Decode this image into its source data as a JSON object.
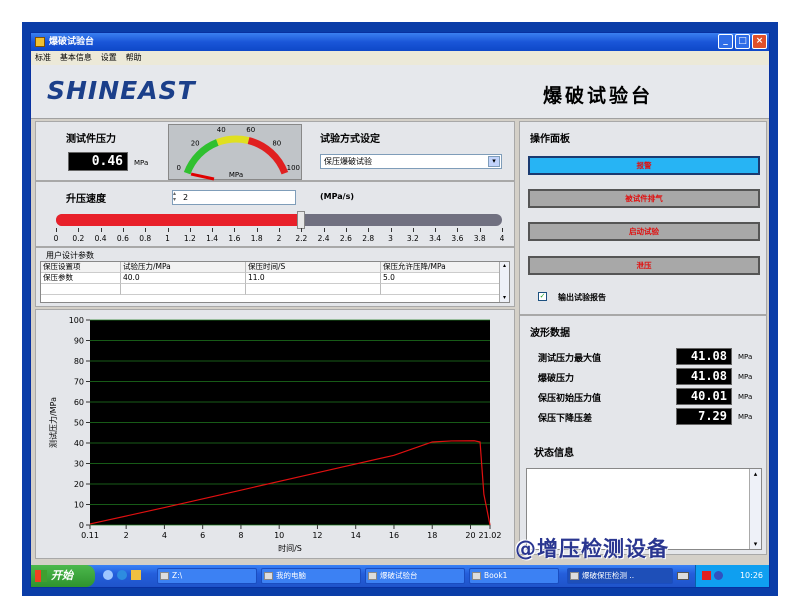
{
  "window": {
    "title": "爆破试验台"
  },
  "menu": [
    "标准",
    "基本信息",
    "设置",
    "帮助"
  ],
  "header": {
    "logo": "SHINEAST",
    "app_title": "爆破试验台"
  },
  "pressure": {
    "label": "测试件压力",
    "value": "0.46",
    "unit": "MPa"
  },
  "gauge": {
    "unit": "MPa",
    "ticks": [
      "0",
      "20",
      "40",
      "60",
      "80",
      "100"
    ],
    "needle_value": 0.46,
    "max": 100
  },
  "mode": {
    "label": "试验方式设定",
    "selected": "保压爆破试验"
  },
  "rate": {
    "label": "升压速度",
    "value": "2",
    "unit": "(MPa/s)",
    "slider_fraction": 0.55,
    "ticks": [
      "0",
      "0.2",
      "0.4",
      "0.6",
      "0.8",
      "1",
      "1.2",
      "1.4",
      "1.6",
      "1.8",
      "2",
      "2.2",
      "2.4",
      "2.6",
      "2.8",
      "3",
      "3.2",
      "3.4",
      "3.6",
      "3.8",
      "4"
    ]
  },
  "params": {
    "title": "用户设计参数",
    "headers": [
      "保压设置项",
      "试验压力/MPa",
      "保压时间/S",
      "保压允许压降/MPa"
    ],
    "rows": [
      [
        "保压参数",
        "40.0",
        "11.0",
        "5.0"
      ]
    ]
  },
  "ops": {
    "title": "操作面板",
    "buttons": [
      "报警",
      "被试件排气",
      "启动试验",
      "泄压"
    ],
    "export_label": "输出试验报告",
    "export_checked": true
  },
  "wave": {
    "title": "波形数据",
    "rows": [
      {
        "label": "测试压力最大值",
        "value": "41.08",
        "unit": "MPa"
      },
      {
        "label": "爆破压力",
        "value": "41.08",
        "unit": "MPa"
      },
      {
        "label": "保压初始压力值",
        "value": "40.01",
        "unit": "MPa"
      },
      {
        "label": "保压下降压差",
        "value": "7.29",
        "unit": "MPa"
      }
    ]
  },
  "status": {
    "title": "状态信息"
  },
  "chart_data": {
    "type": "line",
    "xlabel": "时间/S",
    "ylabel": "测试压力/MPa",
    "xlim": [
      0.11,
      21.02
    ],
    "ylim": [
      0,
      100
    ],
    "x_ticks": [
      "0.11",
      "2",
      "4",
      "6",
      "8",
      "10",
      "12",
      "14",
      "16",
      "18",
      "20",
      "21.02"
    ],
    "y_ticks": [
      "0",
      "10",
      "20",
      "30",
      "40",
      "50",
      "60",
      "70",
      "80",
      "90",
      "100"
    ],
    "series": [
      {
        "x": [
          0.11,
          4,
          8,
          12,
          16,
          18,
          19,
          20.2,
          20.5,
          20.7,
          21.02
        ],
        "y": [
          0.5,
          8.5,
          17,
          25.5,
          34,
          40.5,
          41,
          41.08,
          40.5,
          15,
          0
        ]
      }
    ],
    "colors": {
      "background": "#000000",
      "line": "#e01010",
      "grid": "#1f7a1f"
    }
  },
  "taskbar": {
    "start": "开始",
    "items": [
      "Z:\\",
      "我的电脑",
      "爆破试验台",
      "Book1",
      "爆破保压检测 .."
    ],
    "clock": "10:26"
  },
  "watermark": "@增压检测设备"
}
